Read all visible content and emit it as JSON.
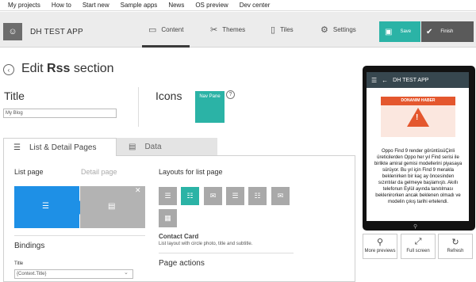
{
  "topnav": [
    "My projects",
    "How to",
    "Start new",
    "Sample apps",
    "News",
    "OS preview",
    "Dev center"
  ],
  "app": {
    "name": "DH TEST APP"
  },
  "tabs": {
    "content": "Content",
    "themes": "Themes",
    "tiles": "Tiles",
    "settings": "Settings"
  },
  "actions": {
    "save": "Save",
    "finish": "Finish"
  },
  "page": {
    "edit_prefix": "Edit",
    "section": "Rss",
    "suffix": "section"
  },
  "title_field": {
    "label": "Title",
    "value": "My Blog"
  },
  "icons": {
    "label": "Icons",
    "tile_label": "Nav Pane",
    "help": "?"
  },
  "section_tabs": {
    "list_detail": "List & Detail Pages",
    "data": "Data"
  },
  "pages": {
    "list": "List page",
    "detail": "Detail page"
  },
  "layouts": {
    "heading": "Layouts for list page",
    "selected_name": "Contact Card",
    "selected_desc": "List layout with circle photo, title and subtitle."
  },
  "page_actions": "Page actions",
  "bindings": {
    "heading": "Bindings",
    "title_label": "Title",
    "title_value": "{Context.Title}"
  },
  "phone": {
    "header": "DH TEST APP",
    "banner_top": "DONANIM HABER",
    "article": "Oppo Find 9 render görüntüsüÇinli üreticilerden Oppo her yıl Find serisi ile birlikte amiral gemisi modellerini piyasaya sürüyor. Bu yıl için Find 9 merakla beklenirken bir kaç ay öncesinden sızıntılar da gelmeye başlamıştı. Akıllı telefonun Eylül ayında tanıtılması beklenirorken ancak beklenen olmadı ve modelin çıkış tarihi ertelendi."
  },
  "preview": {
    "more": "More previews",
    "full": "Full screen",
    "refresh": "Refresh"
  },
  "colors": {
    "accent": "#2bb3a6",
    "list_blue": "#1e90e6",
    "phone_header": "#37474f"
  }
}
